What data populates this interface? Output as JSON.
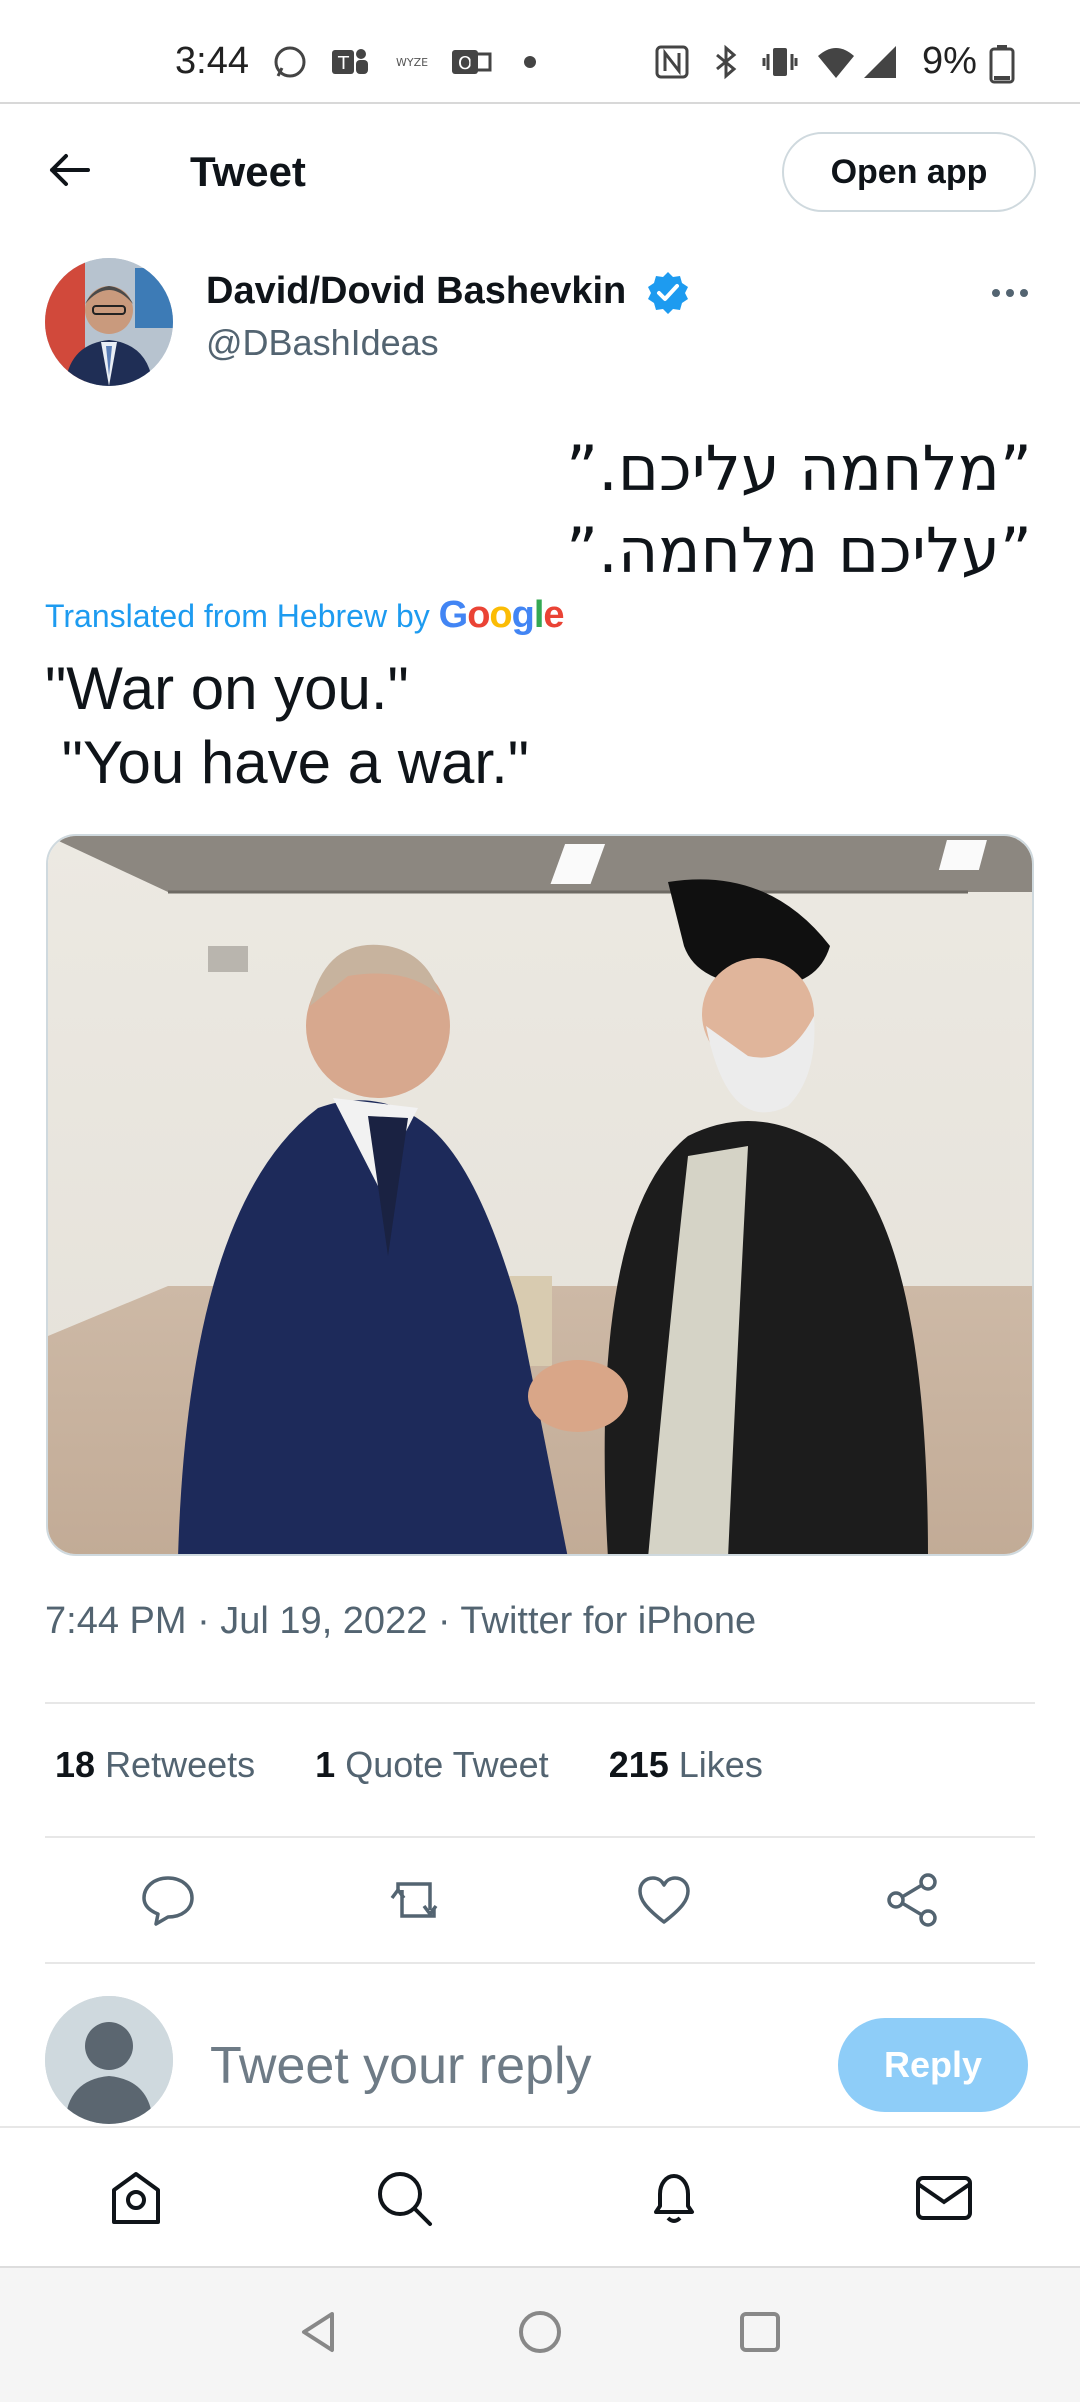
{
  "status_bar": {
    "time": "3:44",
    "battery": "9%",
    "left_icons": [
      "whatsapp-icon",
      "teams-icon",
      "wyze-icon",
      "outlook-icon",
      "dot-icon"
    ],
    "right_icons": [
      "nfc-icon",
      "bluetooth-icon",
      "vibrate-icon",
      "wifi-icon",
      "signal-icon",
      "battery-icon"
    ]
  },
  "header": {
    "title": "Tweet",
    "open_app_label": "Open app"
  },
  "author": {
    "name": "David/Dovid Bashevkin",
    "handle": "@DBashIdeas",
    "verified": true
  },
  "tweet": {
    "hebrew_lines": [
      "”מלחמה עליכם.”",
      "”עליכם מלחמה.”"
    ],
    "translated_label": "Translated from Hebrew by",
    "translator": "Google",
    "english": "\"War on you.\"\n \"You have a war.\"",
    "meta": "7:44 PM · Jul 19, 2022 · Twitter for iPhone"
  },
  "stats": {
    "retweets_count": "18",
    "retweets_label": "Retweets",
    "quotes_count": "1",
    "quotes_label": "Quote Tweet",
    "likes_count": "215",
    "likes_label": "Likes"
  },
  "reply": {
    "placeholder": "Tweet your reply",
    "button_label": "Reply"
  },
  "colors": {
    "accent": "#1d9bf0",
    "reply_disabled": "#8ecdf8",
    "muted": "#536471"
  }
}
